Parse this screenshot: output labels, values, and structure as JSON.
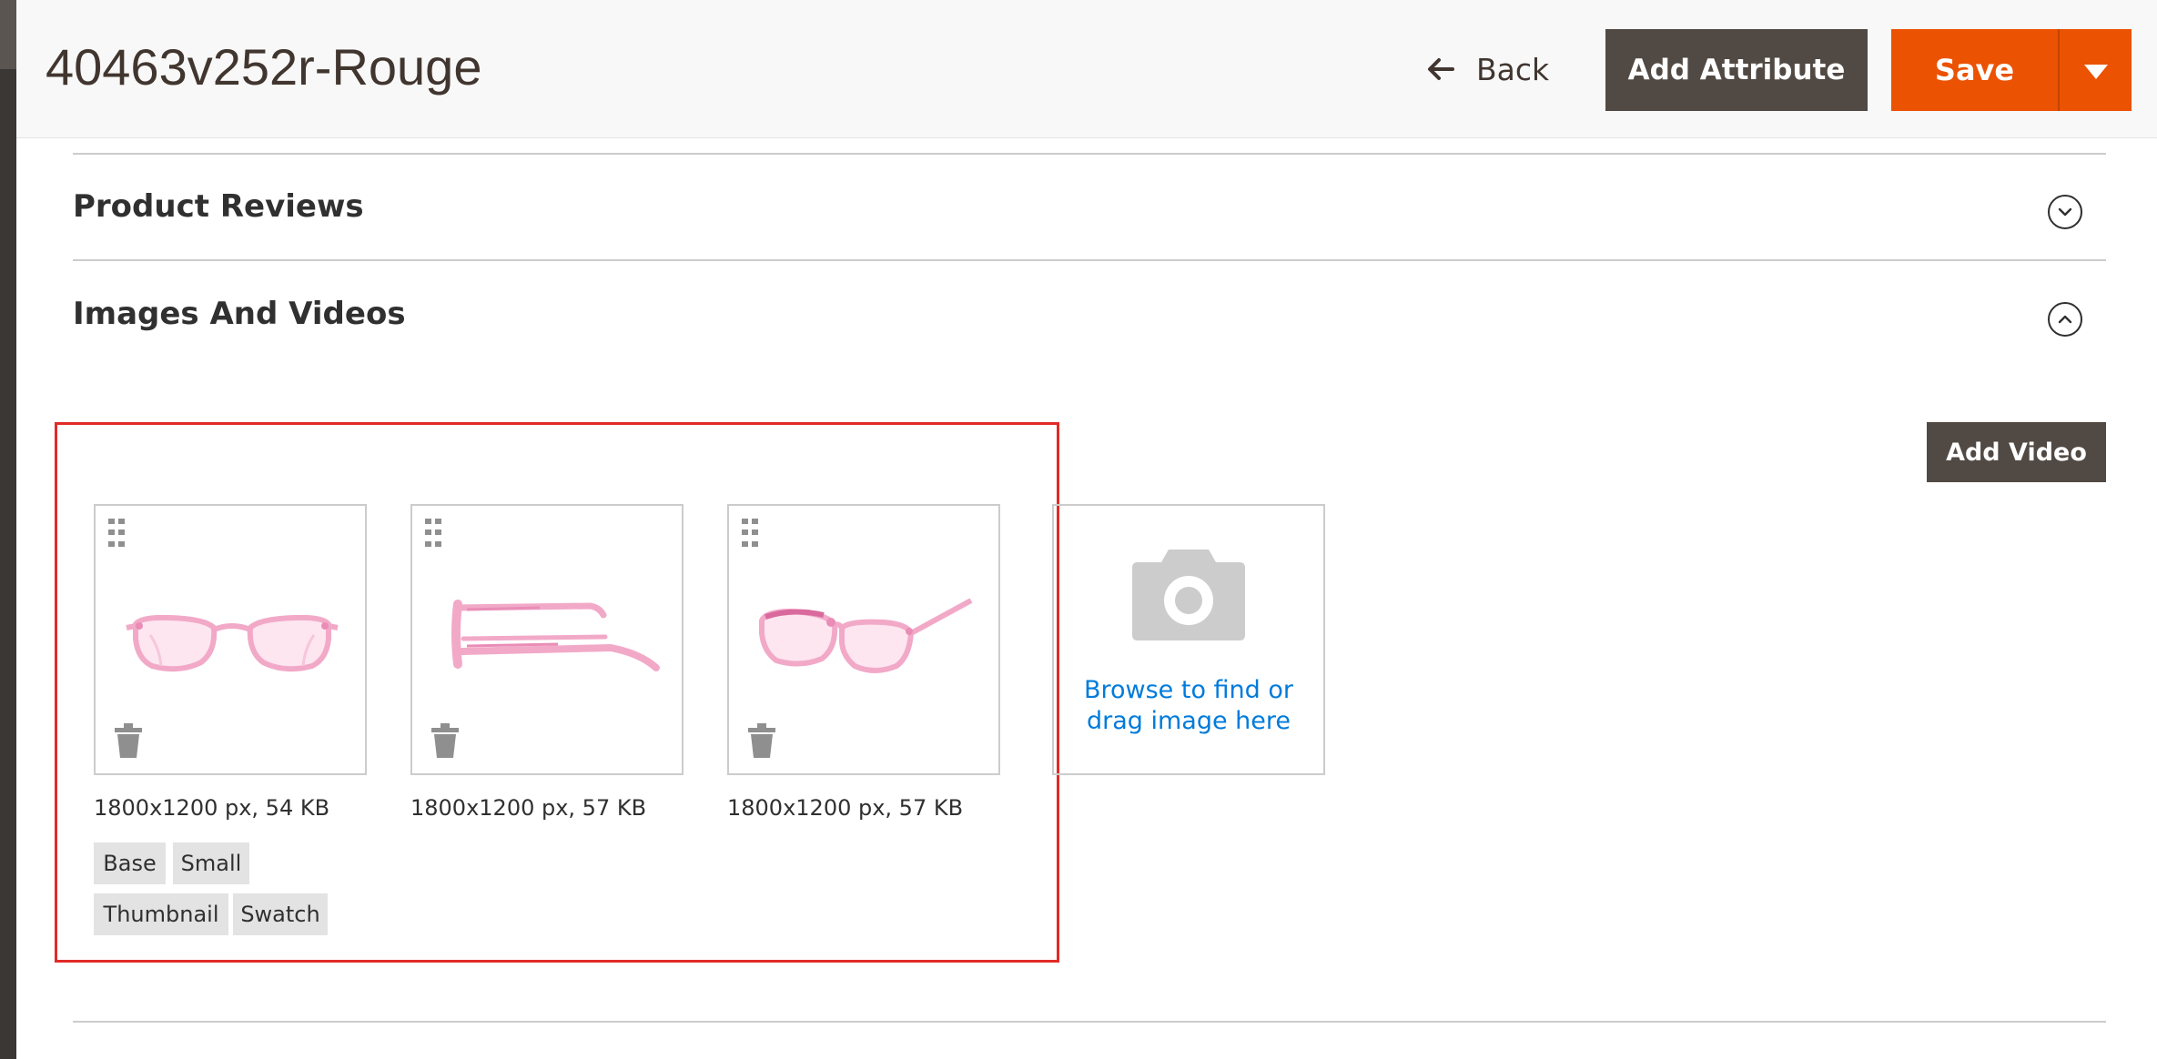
{
  "header": {
    "title": "40463v252r-Rouge",
    "back_label": "Back",
    "add_attribute_label": "Add Attribute",
    "save_label": "Save"
  },
  "sections": {
    "reviews_title": "Product Reviews",
    "images_title": "Images And Videos"
  },
  "images": {
    "add_video_label": "Add Video",
    "items": [
      {
        "meta": "1800x1200 px, 54 KB",
        "view": "front",
        "roles": [
          "Base",
          "Small",
          "Thumbnail",
          "Swatch"
        ]
      },
      {
        "meta": "1800x1200 px, 57 KB",
        "view": "side",
        "roles": []
      },
      {
        "meta": "1800x1200 px, 57 KB",
        "view": "angled",
        "roles": []
      }
    ],
    "uploader_line1": "Browse to find or",
    "uploader_line2": "drag image here"
  },
  "colors": {
    "accent_orange": "#eb5202",
    "dark_button": "#514943",
    "link_blue": "#007bdb",
    "highlight_red": "#e02b27",
    "frame_pink": "#f2a9c8"
  },
  "icons": [
    "arrow-left-icon",
    "caret-down-icon",
    "chevron-down-icon",
    "chevron-up-icon",
    "drag-handle-icon",
    "trash-icon",
    "camera-icon"
  ]
}
